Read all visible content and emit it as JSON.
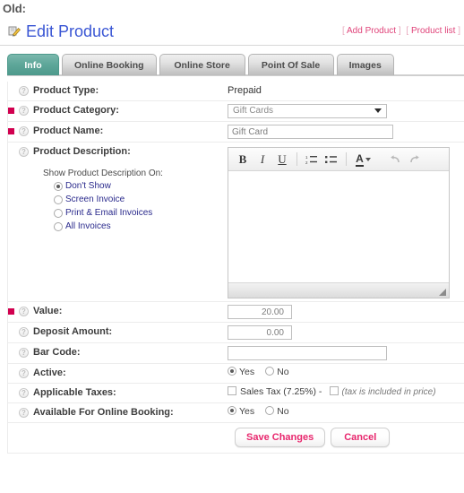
{
  "caption": "Old:",
  "header": {
    "title": "Edit Product",
    "edit_icon": "pencil-document-icon",
    "links": [
      {
        "label": "Add Product",
        "open": "[",
        "close": "]"
      },
      {
        "label": "Product list",
        "open": "[",
        "close": "]"
      }
    ]
  },
  "tabs": [
    {
      "label": "Info",
      "active": true
    },
    {
      "label": "Online Booking",
      "active": false
    },
    {
      "label": "Online Store",
      "active": false
    },
    {
      "label": "Point Of Sale",
      "active": false
    },
    {
      "label": "Images",
      "active": false
    }
  ],
  "form": {
    "product_type": {
      "label": "Product Type:",
      "value": "Prepaid",
      "required": false,
      "help_icon": "question-help-icon"
    },
    "product_category": {
      "label": "Product Category:",
      "value": "Gift Cards",
      "required": true,
      "help_icon": "question-help-icon",
      "options": [
        "Gift Cards"
      ]
    },
    "product_name": {
      "label": "Product Name:",
      "value": "Gift Card",
      "required": true,
      "help_icon": "question-help-icon"
    },
    "product_description": {
      "label": "Product Description:",
      "required": false,
      "help_icon": "question-help-icon",
      "show_on_label": "Show Product Description On:",
      "options": [
        {
          "label": "Don't Show",
          "selected": true
        },
        {
          "label": "Screen Invoice",
          "selected": false
        },
        {
          "label": "Print & Email Invoices",
          "selected": false
        },
        {
          "label": "All Invoices",
          "selected": false
        }
      ],
      "editor": {
        "content": "",
        "toolbar": [
          {
            "name": "bold-button",
            "glyph": "B"
          },
          {
            "name": "italic-button",
            "glyph": "I"
          },
          {
            "name": "underline-button",
            "glyph": "U"
          },
          {
            "name": "ordered-list-button",
            "glyph": "list-ordered-icon"
          },
          {
            "name": "unordered-list-button",
            "glyph": "list-bullet-icon"
          },
          {
            "name": "font-color-button",
            "glyph": "A"
          },
          {
            "name": "undo-button",
            "glyph": "↰"
          },
          {
            "name": "redo-button",
            "glyph": "↱"
          }
        ]
      }
    },
    "value": {
      "label": "Value:",
      "value": "20.00",
      "required": true,
      "help_icon": "question-help-icon"
    },
    "deposit_amount": {
      "label": "Deposit Amount:",
      "value": "0.00",
      "required": false,
      "help_icon": "question-help-icon"
    },
    "bar_code": {
      "label": "Bar Code:",
      "value": "",
      "required": false,
      "help_icon": "question-help-icon"
    },
    "active": {
      "label": "Active:",
      "required": false,
      "help_icon": "question-help-icon",
      "yes_label": "Yes",
      "no_label": "No",
      "selected": "Yes"
    },
    "applicable_taxes": {
      "label": "Applicable Taxes:",
      "required": false,
      "help_icon": "question-help-icon",
      "tax_label": "Sales Tax (7.25%) -",
      "tax_checked": false,
      "included_checked": false,
      "included_note": "(tax is included in price)"
    },
    "available_online_booking": {
      "label": "Available For Online Booking:",
      "required": false,
      "help_icon": "question-help-icon",
      "yes_label": "Yes",
      "no_label": "No",
      "selected": "Yes"
    }
  },
  "actions": {
    "save_label": "Save Changes",
    "cancel_label": "Cancel"
  },
  "colors": {
    "accent_tab": "#4d998b",
    "required_marker": "#d1004f",
    "link_pink": "#e0447a",
    "title_blue": "#3a56d4",
    "radio_label_blue": "#2a2a8c"
  }
}
